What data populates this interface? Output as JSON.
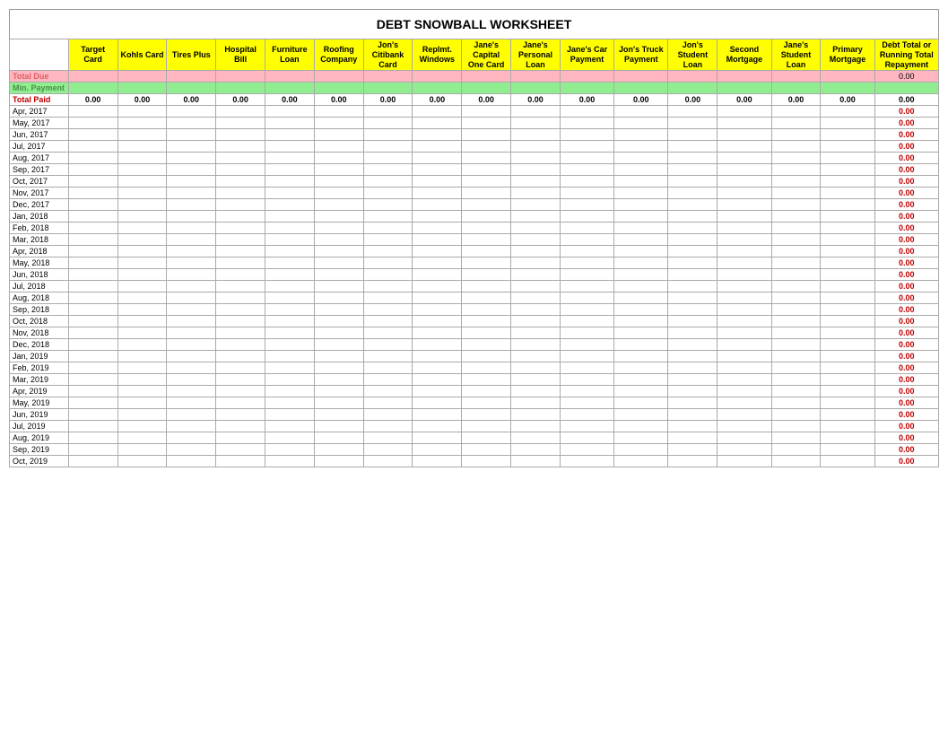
{
  "title": "DEBT SNOWBALL WORKSHEET",
  "columns": [
    {
      "id": "date",
      "label": "",
      "label2": "",
      "label3": ""
    },
    {
      "id": "target-card",
      "label": "Target",
      "label2": "Card",
      "label3": ""
    },
    {
      "id": "kohls-card",
      "label": "Kohls Card",
      "label2": "",
      "label3": ""
    },
    {
      "id": "tires-plus",
      "label": "Tires Plus",
      "label2": "",
      "label3": ""
    },
    {
      "id": "hospital-bill",
      "label": "Hospital",
      "label2": "Bill",
      "label3": ""
    },
    {
      "id": "furniture-loan",
      "label": "Furniture",
      "label2": "Loan",
      "label3": ""
    },
    {
      "id": "roofing-company",
      "label": "Roofing",
      "label2": "Company",
      "label3": ""
    },
    {
      "id": "jons-citibank",
      "label": "Jon's",
      "label2": "Citibank",
      "label3": "Card"
    },
    {
      "id": "replmt-windows",
      "label": "Replmt.",
      "label2": "Windows",
      "label3": ""
    },
    {
      "id": "janes-capital-one",
      "label": "Jane's",
      "label2": "Capital",
      "label3": "One Card"
    },
    {
      "id": "janes-personal-loan",
      "label": "Jane's",
      "label2": "Personal",
      "label3": "Loan"
    },
    {
      "id": "janes-car-payment",
      "label": "Jane's Car",
      "label2": "Payment",
      "label3": ""
    },
    {
      "id": "jons-truck-payment",
      "label": "Jon's Truck",
      "label2": "Payment",
      "label3": ""
    },
    {
      "id": "jons-student-loan",
      "label": "Jon's",
      "label2": "Student",
      "label3": "Loan"
    },
    {
      "id": "second-mortgage",
      "label": "Second",
      "label2": "Mortgage",
      "label3": ""
    },
    {
      "id": "janes-student-loan",
      "label": "Jane's",
      "label2": "Student",
      "label3": "Loan"
    },
    {
      "id": "primary-mortgage",
      "label": "Primary",
      "label2": "Mortgage",
      "label3": ""
    },
    {
      "id": "debt-total",
      "label": "Debt Total or",
      "label2": "Running Total",
      "label3": "Repayment"
    }
  ],
  "special_rows": {
    "total_due": {
      "label": "Total Due",
      "last_value": "0.00"
    },
    "min_payment": {
      "label": "Min. Payment"
    },
    "total_paid": {
      "label": "Total Paid",
      "values": [
        "0.00",
        "0.00",
        "0.00",
        "0.00",
        "0.00",
        "0.00",
        "0.00",
        "0.00",
        "0.00",
        "0.00",
        "0.00",
        "0.00",
        "0.00",
        "0.00",
        "0.00",
        "0.00",
        "0.00"
      ]
    }
  },
  "data_rows": [
    {
      "date": "Apr, 2017",
      "value": "0.00"
    },
    {
      "date": "May, 2017",
      "value": "0.00"
    },
    {
      "date": "Jun, 2017",
      "value": "0.00"
    },
    {
      "date": "Jul, 2017",
      "value": "0.00"
    },
    {
      "date": "Aug, 2017",
      "value": "0.00"
    },
    {
      "date": "Sep, 2017",
      "value": "0.00"
    },
    {
      "date": "Oct, 2017",
      "value": "0.00"
    },
    {
      "date": "Nov, 2017",
      "value": "0.00"
    },
    {
      "date": "Dec, 2017",
      "value": "0.00"
    },
    {
      "date": "Jan, 2018",
      "value": "0.00"
    },
    {
      "date": "Feb, 2018",
      "value": "0.00"
    },
    {
      "date": "Mar, 2018",
      "value": "0.00"
    },
    {
      "date": "Apr, 2018",
      "value": "0.00"
    },
    {
      "date": "May, 2018",
      "value": "0.00"
    },
    {
      "date": "Jun, 2018",
      "value": "0.00"
    },
    {
      "date": "Jul, 2018",
      "value": "0.00"
    },
    {
      "date": "Aug, 2018",
      "value": "0.00"
    },
    {
      "date": "Sep, 2018",
      "value": "0.00"
    },
    {
      "date": "Oct, 2018",
      "value": "0.00"
    },
    {
      "date": "Nov, 2018",
      "value": "0.00"
    },
    {
      "date": "Dec, 2018",
      "value": "0.00"
    },
    {
      "date": "Jan, 2019",
      "value": "0.00"
    },
    {
      "date": "Feb, 2019",
      "value": "0.00"
    },
    {
      "date": "Mar, 2019",
      "value": "0.00"
    },
    {
      "date": "Apr, 2019",
      "value": "0.00"
    },
    {
      "date": "May, 2019",
      "value": "0.00"
    },
    {
      "date": "Jun, 2019",
      "value": "0.00"
    },
    {
      "date": "Jul, 2019",
      "value": "0.00"
    },
    {
      "date": "Aug, 2019",
      "value": "0.00"
    },
    {
      "date": "Sep, 2019",
      "value": "0.00"
    },
    {
      "date": "Oct, 2019",
      "value": "0.00"
    }
  ]
}
